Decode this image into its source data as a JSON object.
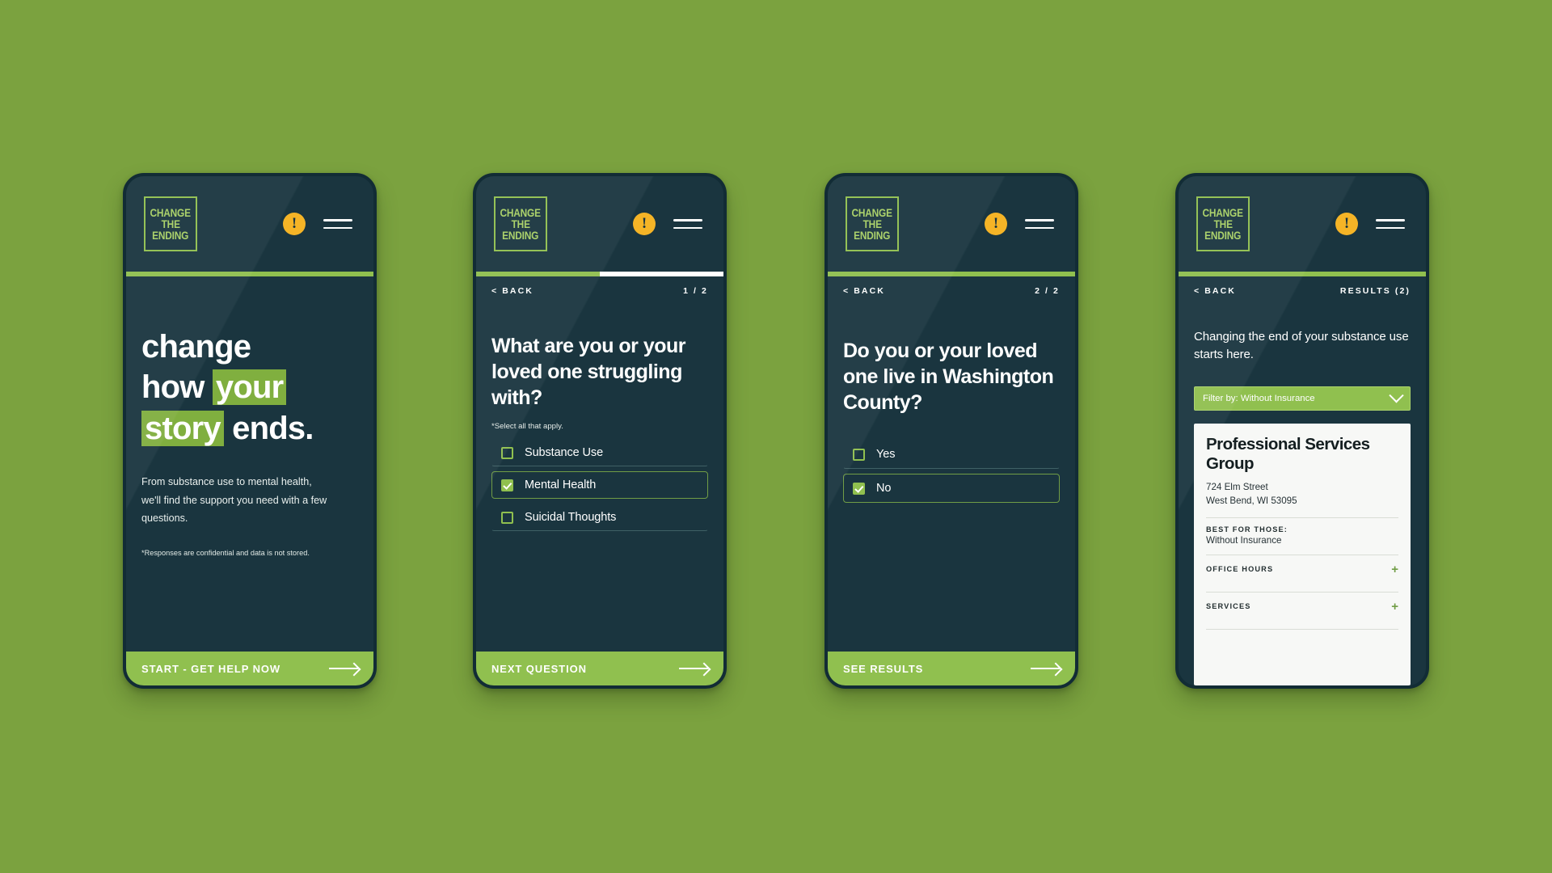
{
  "background_color": "#7ba23f",
  "brand": {
    "logo_line1": "CHANGE",
    "logo_line2": "THE",
    "logo_line3": "ENDING",
    "accent_green": "#8fbf4d",
    "dark": "#17333d",
    "alert_color": "#f5b324"
  },
  "icons": {
    "alert": "!",
    "plus": "+"
  },
  "screens": [
    {
      "id": "home",
      "headline": {
        "line1_plain": "change",
        "line2_plain": "how ",
        "line2_highlight": "your",
        "line3_highlight": "story",
        "line3_plain": " ends."
      },
      "body": "From substance use to mental health, we'll find the support you need with a few questions.",
      "note": "*Responses are confidential and data is not stored.",
      "cta": "START - GET HELP NOW"
    },
    {
      "id": "question-1",
      "back": "< BACK",
      "counter": "1 / 2",
      "progress_percent": 50,
      "question": "What are you or your loved one struggling with?",
      "select_note": "*Select all that apply.",
      "options": [
        {
          "label": "Substance Use",
          "checked": false
        },
        {
          "label": "Mental Health",
          "checked": true
        },
        {
          "label": "Suicidal Thoughts",
          "checked": false
        }
      ],
      "cta": "NEXT QUESTION"
    },
    {
      "id": "question-2",
      "back": "< BACK",
      "counter": "2 / 2",
      "progress_percent": 100,
      "question": "Do you or your loved one live in Washington County?",
      "options": [
        {
          "label": "Yes",
          "checked": false
        },
        {
          "label": "No",
          "checked": true
        }
      ],
      "cta": "SEE RESULTS"
    },
    {
      "id": "results",
      "back": "< BACK",
      "counter": "RESULTS (2)",
      "progress_percent": 100,
      "intro": "Changing the end of your substance use starts here.",
      "filter_label": "Filter by: Without Insurance",
      "card": {
        "name": "Professional Services Group",
        "address_line1": "724 Elm Street",
        "address_line2": "West Bend, WI 53095",
        "best_for_label": "BEST FOR THOSE:",
        "best_for_value": "Without Insurance",
        "accordion": [
          {
            "label": "OFFICE HOURS"
          },
          {
            "label": "SERVICES"
          }
        ]
      }
    }
  ]
}
